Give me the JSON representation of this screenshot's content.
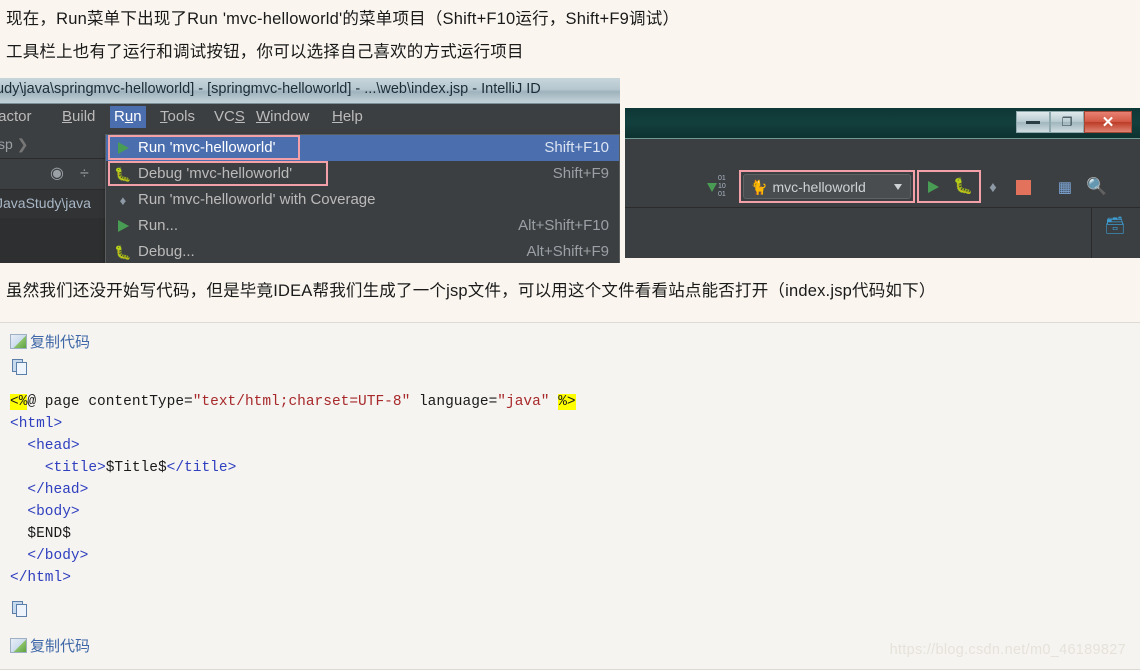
{
  "prose": {
    "p1": "现在，Run菜单下出现了Run 'mvc-helloworld'的菜单项目（Shift+F10运行，Shift+F9调试）",
    "p2": "工具栏上也有了运行和调试按钮，你可以选择自己喜欢的方式运行项目",
    "p3": "虽然我们还没开始写代码，但是毕竟IDEA帮我们生成了一个jsp文件，可以用这个文件看看站点能否打开（index.jsp代码如下）"
  },
  "ide": {
    "title_left": "udy\\java\\springmvc-helloworld] - [springmvc-helloworld] - ...\\web\\index.jsp - IntelliJ ID",
    "menus": [
      {
        "label": "factor"
      },
      {
        "label": "Build"
      },
      {
        "label": "Run"
      },
      {
        "label": "Tools"
      },
      {
        "label": "VCS"
      },
      {
        "label": "Window"
      },
      {
        "label": "Help"
      }
    ],
    "breadcrumb": "sp",
    "path_text": "JavaStudy\\java",
    "run_menu": [
      {
        "label": "Run 'mvc-helloworld'",
        "shortcut": "Shift+F10",
        "icon": "run-icon",
        "highlighted": true,
        "boxed": true
      },
      {
        "label": "Debug 'mvc-helloworld'",
        "shortcut": "Shift+F9",
        "icon": "debug-icon",
        "highlighted": false,
        "boxed": true
      },
      {
        "label": "Run 'mvc-helloworld' with Coverage",
        "shortcut": "",
        "icon": "coverage-icon",
        "highlighted": false,
        "boxed": false
      },
      {
        "label": "Run...",
        "shortcut": "Alt+Shift+F10",
        "icon": "run-icon",
        "highlighted": false,
        "boxed": false
      },
      {
        "label": "Debug...",
        "shortcut": "Alt+Shift+F9",
        "icon": "debug-icon",
        "highlighted": false,
        "boxed": false
      }
    ],
    "toolbar": {
      "run_config_name": "mvc-helloworld",
      "run_config_icon": "tomcat-cat-icon",
      "buttons": [
        {
          "name": "run-button",
          "icon": "green-play-icon"
        },
        {
          "name": "debug-button",
          "icon": "green-bug-icon"
        },
        {
          "name": "coverage-button",
          "icon": "coverage-icon"
        },
        {
          "name": "stop-button",
          "icon": "red-stop-square-icon"
        },
        {
          "name": "structure-button",
          "icon": "project-structure-icon"
        },
        {
          "name": "search-button",
          "icon": "magnifier-icon"
        }
      ],
      "bits_top": "01",
      "bits_mid": "10",
      "bits_bot": "01"
    },
    "window_controls": {
      "minimize": "minimize-icon",
      "restore": "❐",
      "close": "✕"
    },
    "accent_pink": "#f4a0a8",
    "accent_green": "#499C54",
    "highlight_blue": "#4b6eaf"
  },
  "code_block": {
    "copy_label_top": "复制代码",
    "copy_label_bottom": "复制代码",
    "lines": [
      "<%@ page contentType=\"text/html;charset=UTF-8\" language=\"java\" %>",
      "<html>",
      "  <head>",
      "    <title>$Title$</title>",
      "  </head>",
      "  <body>",
      "  $END$",
      "  </body>",
      "</html>"
    ]
  },
  "watermark": "https://blog.csdn.net/m0_46189827"
}
